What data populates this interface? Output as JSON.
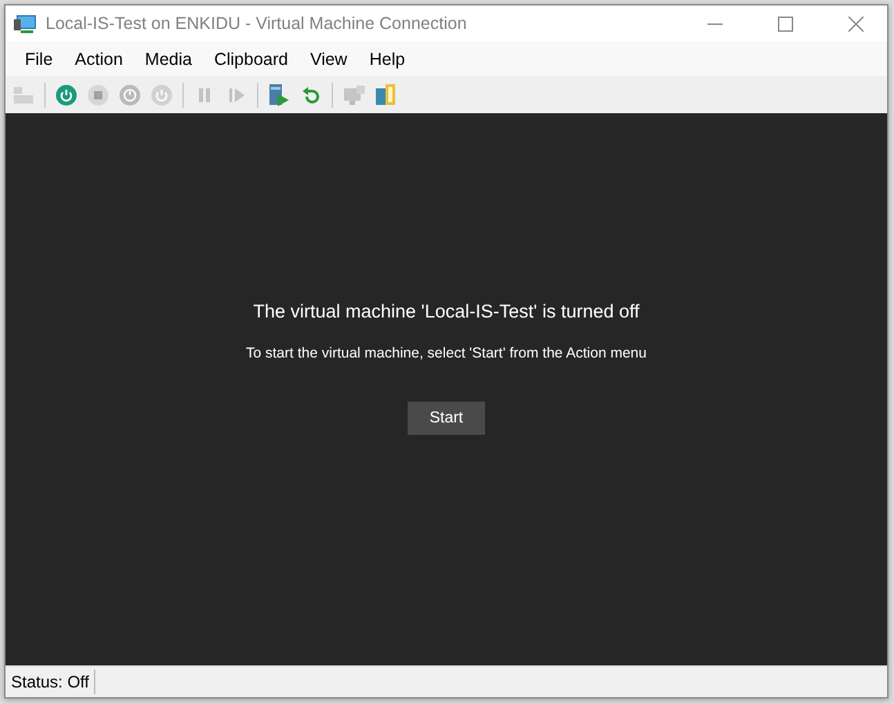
{
  "window": {
    "title": "Local-IS-Test on ENKIDU - Virtual Machine Connection"
  },
  "menu": [
    "File",
    "Action",
    "Media",
    "Clipboard",
    "View",
    "Help"
  ],
  "toolbar": [
    [
      {
        "kind": "ctrl-alt-del",
        "disabled": true
      }
    ],
    [
      {
        "kind": "start",
        "disabled": false
      },
      {
        "kind": "turn-off",
        "disabled": true
      },
      {
        "kind": "shut-down",
        "disabled": true
      },
      {
        "kind": "save",
        "disabled": true
      }
    ],
    [
      {
        "kind": "pause",
        "disabled": true
      },
      {
        "kind": "resume",
        "disabled": true
      }
    ],
    [
      {
        "kind": "checkpoint",
        "disabled": false
      },
      {
        "kind": "revert",
        "disabled": false
      }
    ],
    [
      {
        "kind": "enhanced-session",
        "disabled": true
      },
      {
        "kind": "share",
        "disabled": false
      }
    ]
  ],
  "screen": {
    "heading": "The virtual machine 'Local-IS-Test' is turned off",
    "message": "To start the virtual machine, select 'Start' from the Action menu",
    "button": "Start"
  },
  "status_bar": "Status: Off"
}
